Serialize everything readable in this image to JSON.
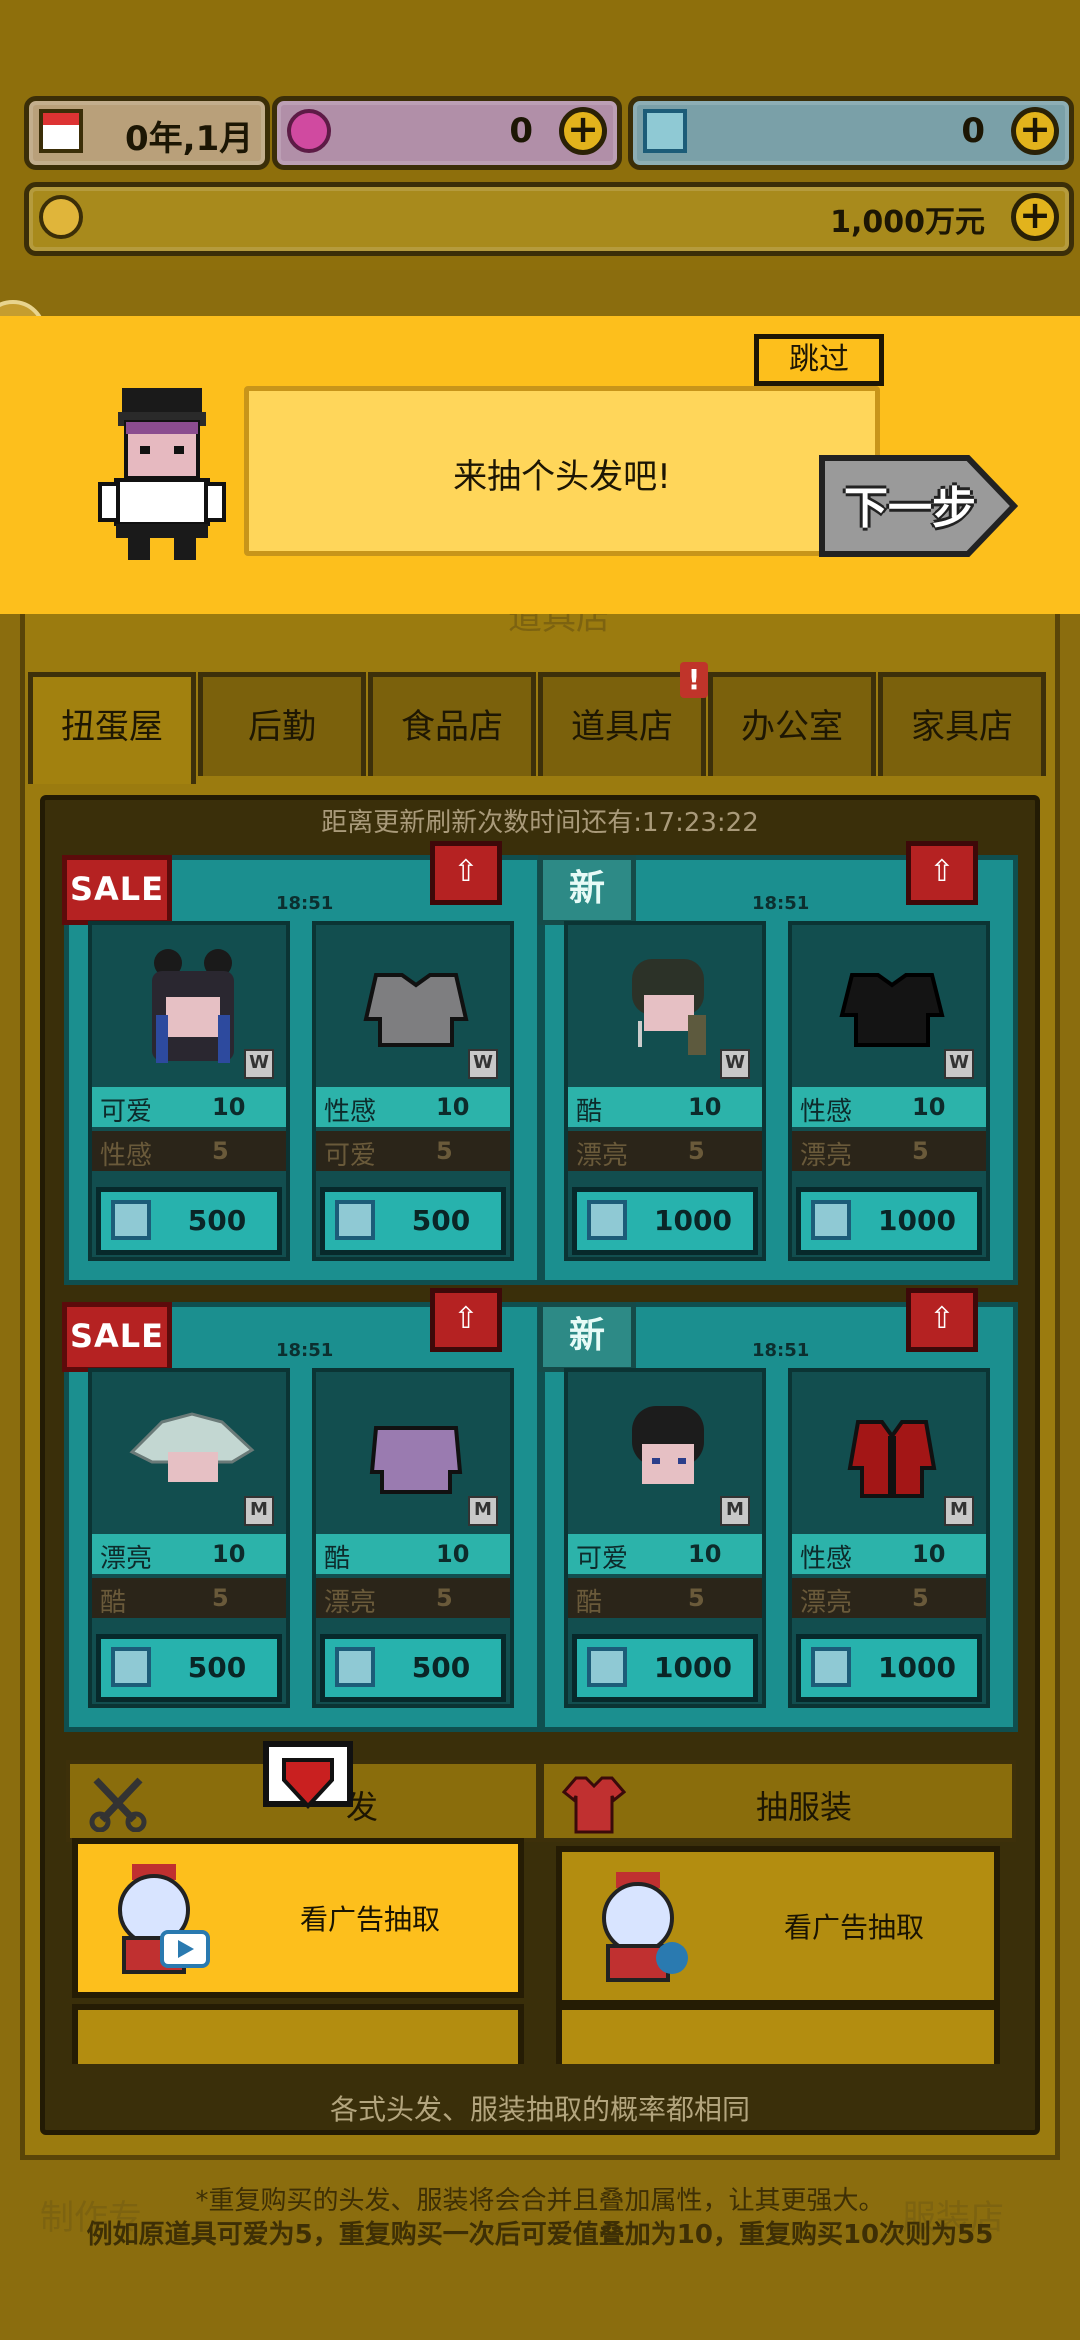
{
  "header": {
    "date": "0年,1月",
    "gems": "0",
    "crystals": "0",
    "money": "1,000万元"
  },
  "tutorial": {
    "skip_label": "跳过",
    "message": "来抽个头发吧!",
    "next_label": "下一步"
  },
  "background": {
    "shop_title": "道具店",
    "bottom_left_text": "制作专",
    "bottom_right_text": "服装店"
  },
  "tabs": [
    {
      "label": "扭蛋屋",
      "active": true
    },
    {
      "label": "后勤"
    },
    {
      "label": "食品店"
    },
    {
      "label": "道具店",
      "alert": "!"
    },
    {
      "label": "办公室"
    },
    {
      "label": "家具店"
    }
  ],
  "shop": {
    "refresh_timer": "距离更新刷新次数时间还有:17:23:22",
    "packs": [
      {
        "badge": "SALE",
        "time": "18:51",
        "items": [
          {
            "size": "W",
            "attr1": "可爱",
            "val1": "10",
            "attr2": "性感",
            "val2": "5",
            "price": "500",
            "kind": "hair"
          },
          {
            "size": "W",
            "attr1": "性感",
            "val1": "10",
            "attr2": "可爱",
            "val2": "5",
            "price": "500",
            "kind": "shirt-gray"
          }
        ]
      },
      {
        "badge": "新",
        "time": "18:51",
        "items": [
          {
            "size": "W",
            "attr1": "酷",
            "val1": "10",
            "attr2": "漂亮",
            "val2": "5",
            "price": "1000",
            "kind": "hair-dark"
          },
          {
            "size": "W",
            "attr1": "性感",
            "val1": "10",
            "attr2": "漂亮",
            "val2": "5",
            "price": "1000",
            "kind": "shirt-black"
          }
        ]
      },
      {
        "badge": "SALE",
        "time": "18:51",
        "items": [
          {
            "size": "M",
            "attr1": "漂亮",
            "val1": "10",
            "attr2": "酷",
            "val2": "5",
            "price": "500",
            "kind": "hair-white"
          },
          {
            "size": "M",
            "attr1": "酷",
            "val1": "10",
            "attr2": "漂亮",
            "val2": "5",
            "price": "500",
            "kind": "shirt-purple"
          }
        ]
      },
      {
        "badge": "新",
        "time": "18:51",
        "items": [
          {
            "size": "M",
            "attr1": "可爱",
            "val1": "10",
            "attr2": "酷",
            "val2": "5",
            "price": "1000",
            "kind": "hair-black"
          },
          {
            "size": "M",
            "attr1": "性感",
            "val1": "10",
            "attr2": "漂亮",
            "val2": "5",
            "price": "1000",
            "kind": "shirt-red"
          }
        ]
      }
    ]
  },
  "draw": {
    "hair_label": "发",
    "clothes_label": "抽服装",
    "hair_ad_label": "看广告抽取",
    "clothes_ad_label": "看广告抽取"
  },
  "footer": {
    "probability": "各式头发、服装抽取的概率都相同",
    "note1": "*重复购买的头发、服装将会合并且叠加属性，让其更强大。",
    "note2": "例如原道具可爱为5，重复购买一次后可爱值叠加为10，重复购买10次则为55"
  },
  "colors": {
    "banner": "#fdbf1c",
    "teal": "#1b8f8f",
    "sale": "#b52222"
  }
}
